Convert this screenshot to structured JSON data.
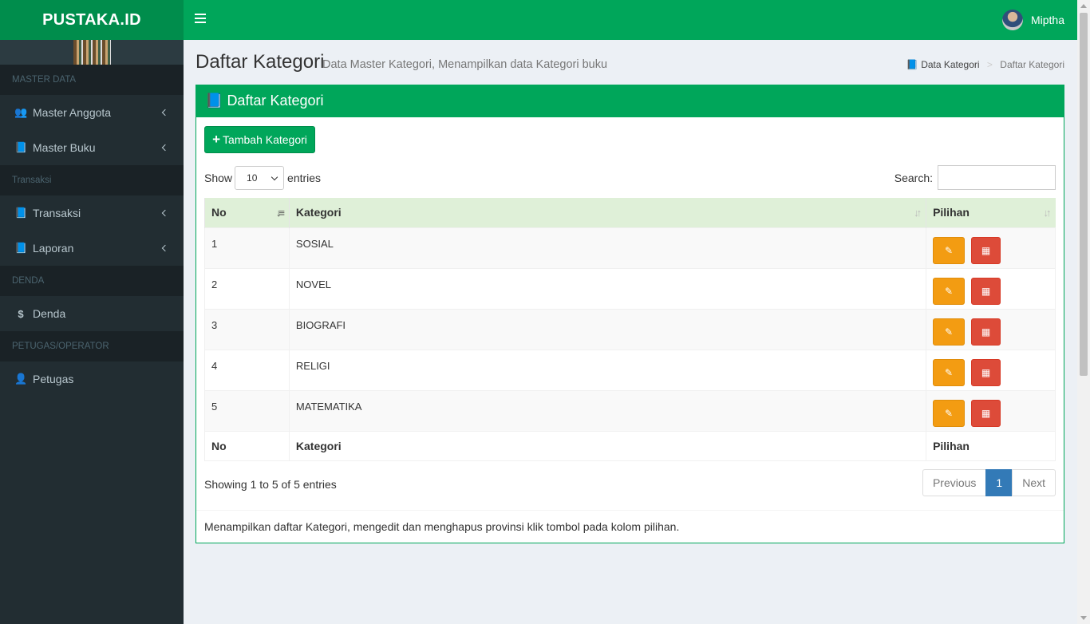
{
  "app": {
    "logo": "PUSTAKA.ID",
    "user_name": "Miptha"
  },
  "sidebar": {
    "sections": [
      {
        "header": "MASTER DATA",
        "items": [
          {
            "label": "Master Anggota",
            "icon": "users-icon"
          },
          {
            "label": "Master Buku",
            "icon": "book-icon"
          }
        ]
      },
      {
        "header": "Transaksi",
        "items": [
          {
            "label": "Transaksi",
            "icon": "book-icon"
          },
          {
            "label": "Laporan",
            "icon": "book-icon"
          }
        ]
      },
      {
        "header": "DENDA",
        "items": [
          {
            "label": "Denda",
            "icon": "dollar-icon"
          }
        ]
      },
      {
        "header": "PETUGAS/OPERATOR",
        "items": [
          {
            "label": "Petugas",
            "icon": "user-plus-icon"
          }
        ]
      }
    ]
  },
  "page": {
    "title": "Daftar Kategori",
    "subtitle": "Data Master Kategori, Menampilkan data Kategori buku",
    "breadcrumb": [
      "Data Kategori",
      "Daftar Kategori"
    ]
  },
  "box": {
    "title": "Daftar Kategori",
    "add_button": "Tambah Kategori",
    "show_label": "Show",
    "entries_label": "entries",
    "page_length": "10",
    "search_label": "Search:",
    "columns": [
      "No",
      "Kategori",
      "Pilihan"
    ],
    "rows": [
      {
        "no": "1",
        "kategori": "SOSIAL"
      },
      {
        "no": "2",
        "kategori": "NOVEL"
      },
      {
        "no": "3",
        "kategori": "BIOGRAFI"
      },
      {
        "no": "4",
        "kategori": "RELIGI"
      },
      {
        "no": "5",
        "kategori": "MATEMATIKA"
      }
    ],
    "info": "Showing 1 to 5 of 5 entries",
    "pagination": {
      "previous": "Previous",
      "current": "1",
      "next": "Next"
    },
    "footer": "Menampilkan daftar Kategori, mengedit dan menghapus provinsi klik tombol pada kolom pilihan."
  },
  "colors": {
    "primary": "#00a65a",
    "logo_bg": "#008d4c",
    "sidebar_bg": "#222d32",
    "edit": "#f39c12",
    "delete": "#dd4b39",
    "page_active": "#337ab7"
  }
}
